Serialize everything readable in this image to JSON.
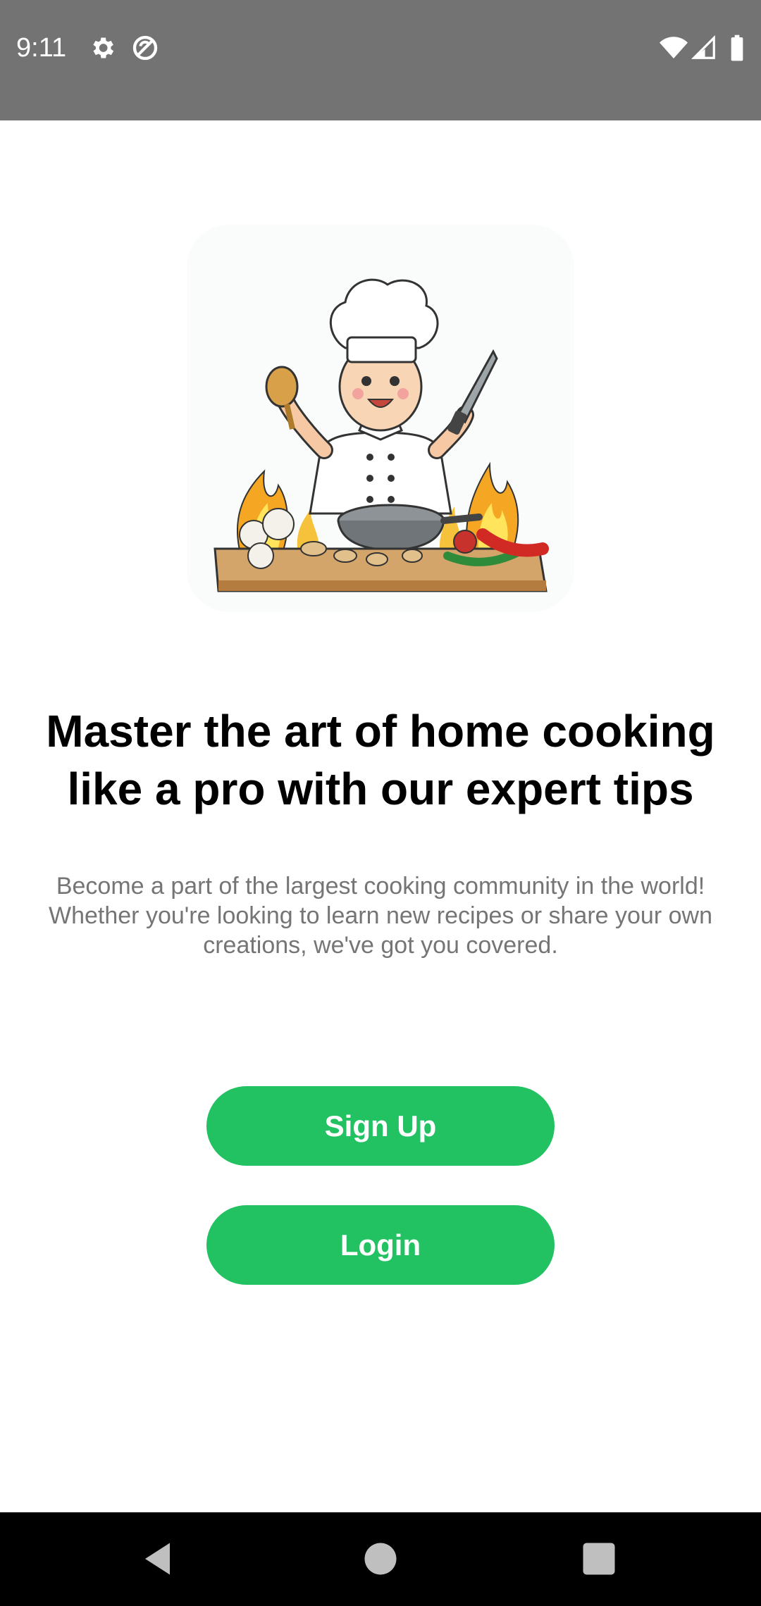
{
  "status_bar": {
    "time": "9:11",
    "icons": [
      "gear-icon",
      "do-not-disturb-icon",
      "wifi-icon",
      "signal-icon",
      "battery-icon"
    ]
  },
  "hero": {
    "image": "chef-cooking-illustration"
  },
  "onboarding": {
    "headline": "Master the art of home cooking like a pro with our expert tips",
    "subtitle": "Become a part of the largest cooking community in the world! Whether you're looking to learn new recipes or share your own creations, we've got you covered."
  },
  "actions": {
    "signup_label": "Sign Up",
    "login_label": "Login"
  },
  "nav_bar": {
    "icons": [
      "back-icon",
      "home-icon",
      "recents-icon"
    ]
  },
  "colors": {
    "accent": "#22C162",
    "status_bar": "#737373",
    "headline": "#000000",
    "subtitle": "#757575"
  }
}
